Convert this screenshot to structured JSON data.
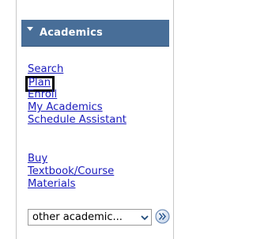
{
  "header": {
    "title": "Academics",
    "icon": "triangle-down-icon"
  },
  "links": [
    {
      "label": "Search"
    },
    {
      "label": "Plan"
    },
    {
      "label": "Enroll"
    },
    {
      "label": "My Academics"
    },
    {
      "label": "Schedule Assistant"
    }
  ],
  "links2": [
    {
      "label": "Buy"
    },
    {
      "label": "Textbook/Course"
    },
    {
      "label": "Materials"
    }
  ],
  "select": {
    "value": "other academic..."
  },
  "go_button": {
    "icon": "double-chevron-right-icon"
  },
  "colors": {
    "header_bg": "#486e98",
    "link": "#1a1bbd",
    "highlight_box": "#000000"
  }
}
